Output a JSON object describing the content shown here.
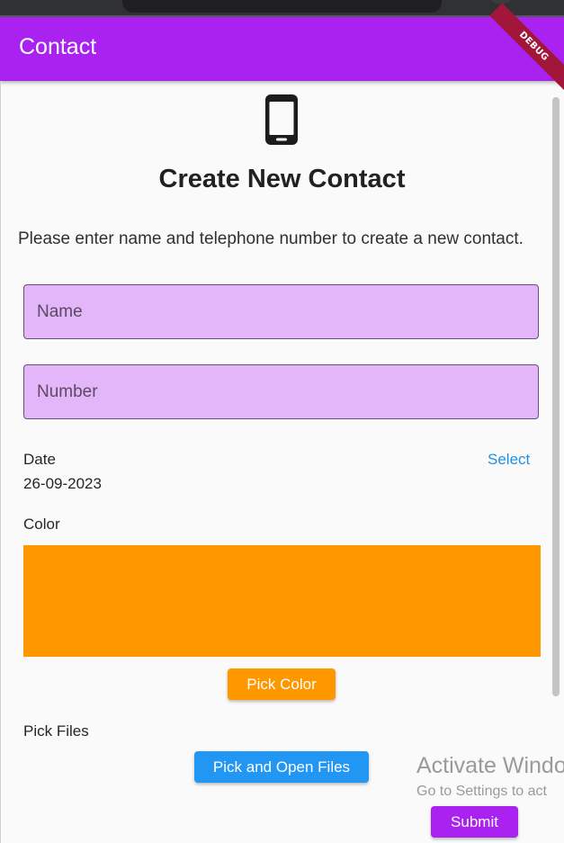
{
  "app_bar": {
    "title": "Contact",
    "debug_banner": "DEBUG"
  },
  "colors": {
    "app_bar": "#aa22f0",
    "input_fill": "#e2b6f8",
    "picked_color": "#ff9800",
    "link": "#1f91e3",
    "files_button": "#2196f3",
    "debug_ribbon": "#a2163b"
  },
  "header": {
    "icon": "phone-icon",
    "title": "Create New Contact",
    "instructions": "Please enter name and telephone number to create a new contact."
  },
  "form": {
    "name": {
      "value": "",
      "placeholder": "Name"
    },
    "number": {
      "value": "",
      "placeholder": "Number"
    },
    "date": {
      "label": "Date",
      "value": "26-09-2023",
      "select_label": "Select"
    },
    "color": {
      "label": "Color",
      "value": "#ff9800",
      "pick_label": "Pick Color"
    },
    "files": {
      "label": "Pick Files",
      "button_label": "Pick and Open Files"
    },
    "submit_label": "Submit"
  },
  "watermark": {
    "title": "Activate Windo",
    "subtitle": "Go to Settings to act"
  }
}
